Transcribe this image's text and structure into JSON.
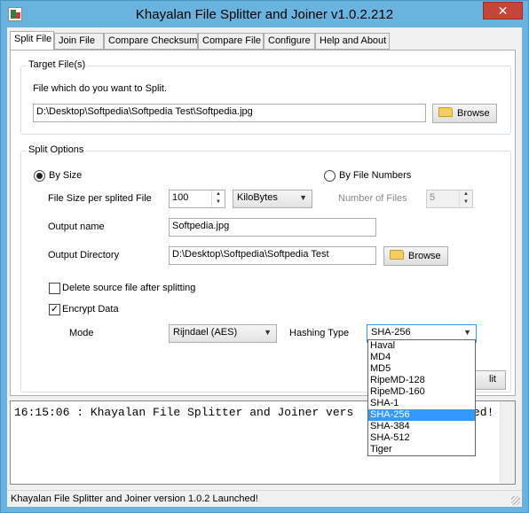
{
  "window": {
    "title": "Khayalan File Splitter and Joiner v1.0.2.212",
    "close_glyph": "✕"
  },
  "tabs": [
    {
      "label": "Split File",
      "active": true
    },
    {
      "label": "Join File"
    },
    {
      "label": "Compare Checksum"
    },
    {
      "label": "Compare File"
    },
    {
      "label": "Configure"
    },
    {
      "label": "Help and About"
    }
  ],
  "target": {
    "group_label": "Target File(s)",
    "description": "File which do you want to Split.",
    "path": "D:\\Desktop\\Softpedia\\Softpedia Test\\Softpedia.jpg",
    "browse_label": "Browse"
  },
  "options": {
    "group_label": "Split Options",
    "by_size_label": "By Size",
    "by_numbers_label": "By File Numbers",
    "size_label": "File Size per splited File",
    "size_value": "100",
    "unit_value": "KiloBytes",
    "num_files_label": "Number of Files",
    "num_files_value": "5",
    "output_name_label": "Output name",
    "output_name_value": "Softpedia.jpg",
    "output_dir_label": "Output Directory",
    "output_dir_value": "D:\\Desktop\\Softpedia\\Softpedia Test",
    "browse_label": "Browse",
    "delete_label": "Delete source file after splitting",
    "encrypt_label": "Encrypt Data",
    "mode_label": "Mode",
    "mode_value": "Rijndael (AES)",
    "hash_label": "Hashing Type",
    "hash_value": "SHA-256",
    "hash_options": [
      "Haval",
      "MD4",
      "MD5",
      "RipeMD-128",
      "RipeMD-160",
      "SHA-1",
      "SHA-256",
      "SHA-384",
      "SHA-512",
      "Tiger"
    ],
    "split_label": "lit"
  },
  "log": {
    "line": "16:15:06 : Khayalan File Splitter and Joiner vers",
    "line_tail": "ed!"
  },
  "status": {
    "text": "Khayalan File Splitter and Joiner version 1.0.2 Launched!"
  },
  "colors": {
    "title_bar": "#6ab3de",
    "close_button": "#c7443a",
    "selection": "#3399ff"
  }
}
